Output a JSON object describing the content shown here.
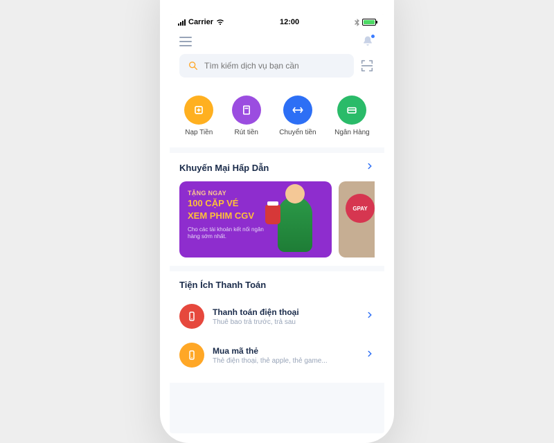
{
  "status": {
    "carrier": "Carrier",
    "time": "12:00"
  },
  "search": {
    "placeholder": "Tìm kiếm dịch vụ bạn cần"
  },
  "quick_actions": [
    {
      "label": "Nạp Tiền",
      "color": "#ffb020"
    },
    {
      "label": "Rút tiền",
      "color": "#9b4de0"
    },
    {
      "label": "Chuyển tiền",
      "color": "#2d6ff5"
    },
    {
      "label": "Ngân Hàng",
      "color": "#2abb69"
    }
  ],
  "promo": {
    "section_title": "Khuyến Mại Hấp Dẫn",
    "gift": "TẶNG NGAY",
    "main1": "100 CẶP VÉ",
    "main2": "XEM PHIM CGV",
    "sub": "Cho các tài khoản kết nối ngân hàng sớm nhất.",
    "badge": "GPAY"
  },
  "utilities": {
    "section_title": "Tiện Ích Thanh Toán",
    "items": [
      {
        "title": "Thanh toán điện thoại",
        "sub": "Thuê bao trả trước, trả sau",
        "color": "#e6483d"
      },
      {
        "title": "Mua mã thẻ",
        "sub": "Thẻ điện thoại, thẻ apple, thẻ game...",
        "color": "#ffa726"
      }
    ]
  }
}
